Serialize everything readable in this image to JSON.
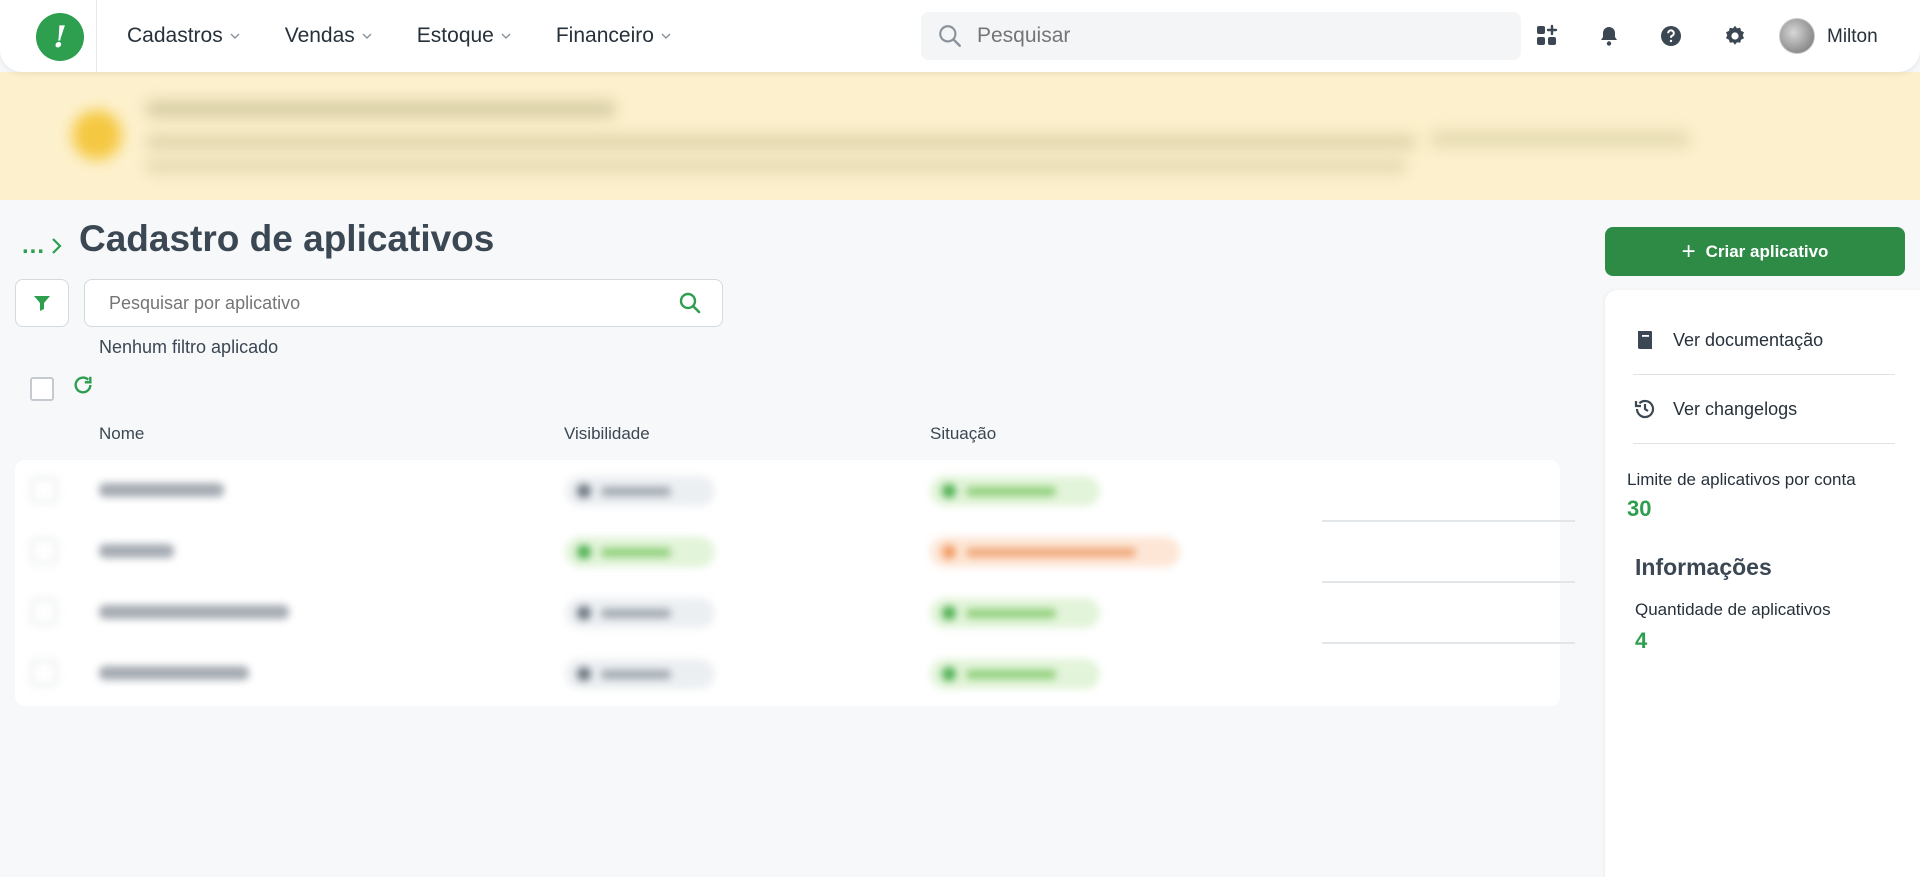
{
  "brand": {
    "logo_glyph": "!",
    "accent": "#2e9e4f",
    "button_color": "#2e8b45"
  },
  "nav": {
    "items": [
      {
        "label": "Cadastros"
      },
      {
        "label": "Vendas"
      },
      {
        "label": "Estoque"
      },
      {
        "label": "Financeiro"
      }
    ],
    "search_placeholder": "Pesquisar",
    "icons": [
      "apps-add-icon",
      "bell-icon",
      "help-icon",
      "gear-icon"
    ],
    "user_name": "Milton"
  },
  "page": {
    "breadcrumb": "...",
    "title": "Cadastro de aplicativos",
    "search_placeholder": "Pesquisar por aplicativo",
    "filter_status": "Nenhum filtro aplicado"
  },
  "table": {
    "columns": [
      "Nome",
      "Visibilidade",
      "Situação"
    ],
    "row_count": 4
  },
  "sidebar": {
    "create_label": "Criar aplicativo",
    "links": [
      {
        "label": "Ver documentação",
        "icon": "book-icon"
      },
      {
        "label": "Ver changelogs",
        "icon": "history-icon"
      }
    ],
    "limit_label": "Limite de aplicativos por conta",
    "limit_value": "30",
    "info_title": "Informações",
    "qty_label": "Quantidade de aplicativos",
    "qty_value": "4"
  }
}
